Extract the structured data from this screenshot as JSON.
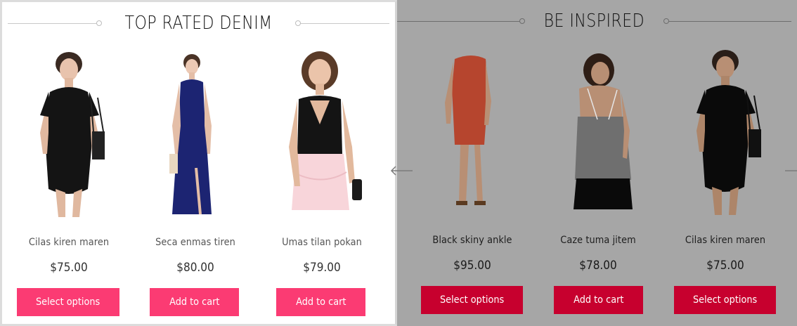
{
  "left_section": {
    "title": "TOP RATED DENIM",
    "products": [
      {
        "name": "Cilas kiren maren",
        "price": "$75.00",
        "button": "Select options",
        "image": "black-bodycon-dress"
      },
      {
        "name": "Seca enmas tiren",
        "price": "$80.00",
        "button": "Add to cart",
        "image": "navy-maxi-dress"
      },
      {
        "name": "Umas tilan pokan",
        "price": "$79.00",
        "button": "Add to cart",
        "image": "black-top-pink-skirt"
      }
    ]
  },
  "right_section": {
    "title": "BE INSPIRED",
    "products": [
      {
        "name": "Black skiny ankle",
        "price": "$95.00",
        "button": "Select options",
        "image": "coral-lace-dress"
      },
      {
        "name": "Caze tuma jitem",
        "price": "$78.00",
        "button": "Add to cart",
        "image": "grey-backless-top"
      },
      {
        "name": "Cilas kiren maren",
        "price": "$75.00",
        "button": "Select options",
        "image": "black-bodycon-dress"
      }
    ]
  },
  "colors": {
    "left_button": "#fb3b73",
    "right_button": "#c7002e",
    "overlay": "#a6a6a6"
  },
  "icons": [
    "prev-arrow-icon",
    "next-arrow-icon",
    "title-dot-icon"
  ]
}
